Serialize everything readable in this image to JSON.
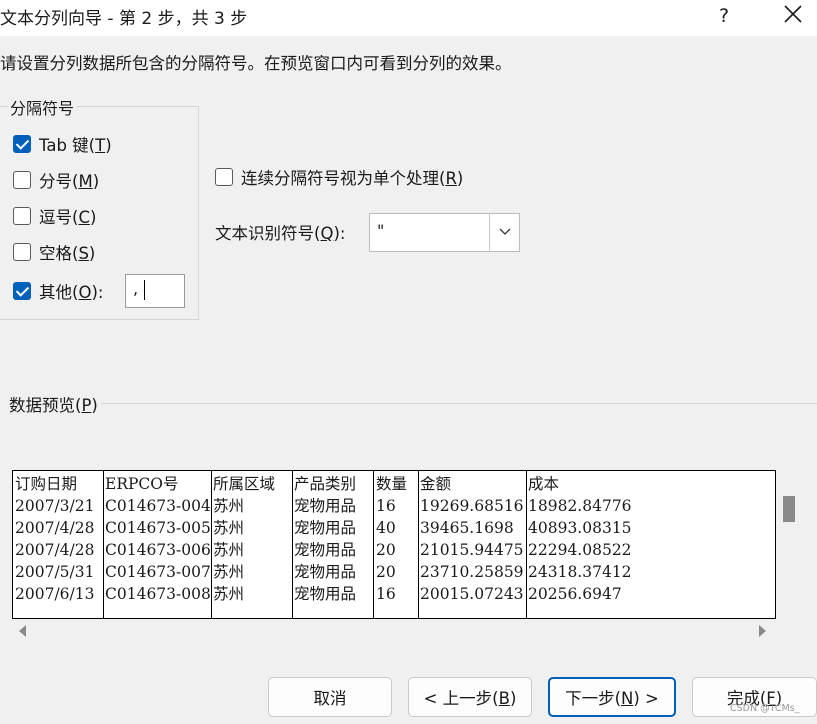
{
  "window": {
    "title": "文本分列向导 - 第 2 步，共 3 步",
    "help_label": "?"
  },
  "instruction": "请设置分列数据所包含的分隔符号。在预览窗口内可看到分列的效果。",
  "delimiters": {
    "group_label": "分隔符号",
    "items": [
      {
        "text": "Tab 键(",
        "key": "T",
        "close": ")",
        "checked": true
      },
      {
        "text": "分号(",
        "key": "M",
        "close": ")",
        "checked": false
      },
      {
        "text": "逗号(",
        "key": "C",
        "close": ")",
        "checked": false
      },
      {
        "text": "空格(",
        "key": "S",
        "close": ")",
        "checked": false
      },
      {
        "text": "其他(",
        "key": "O",
        "close": "):",
        "checked": true
      }
    ],
    "other_value": ","
  },
  "consecutive": {
    "text": "连续分隔符号视为单个处理(",
    "key": "R",
    "close": ")",
    "checked": false
  },
  "text_qualifier": {
    "text": "文本识别符号(",
    "key": "Q",
    "close": "):",
    "value": "\""
  },
  "preview": {
    "label_text": "数据预览(",
    "label_key": "P",
    "label_close": ")",
    "columns": [
      {
        "header": "订购日期",
        "cells": [
          "2007/3/21",
          "2007/4/28",
          "2007/4/28",
          "2007/5/31",
          "2007/6/13"
        ]
      },
      {
        "header": "ERPCO号",
        "cells": [
          "C014673-004",
          "C014673-005",
          "C014673-006",
          "C014673-007",
          "C014673-008"
        ]
      },
      {
        "header": "所属区域",
        "cells": [
          "苏州",
          "苏州",
          "苏州",
          "苏州",
          "苏州"
        ]
      },
      {
        "header": "产品类别",
        "cells": [
          "宠物用品",
          "宠物用品",
          "宠物用品",
          "宠物用品",
          "宠物用品"
        ]
      },
      {
        "header": "数量",
        "cells": [
          "16",
          "40",
          "20",
          "20",
          "16"
        ]
      },
      {
        "header": "金额",
        "cells": [
          "19269.68516",
          "39465.1698",
          "21015.94475",
          "23710.25859",
          "20015.07243"
        ]
      },
      {
        "header": "成本",
        "cells": [
          "18982.84776",
          "40893.08315",
          "22294.08522",
          "24318.37412",
          "20256.6947"
        ]
      }
    ]
  },
  "buttons": {
    "cancel": {
      "text": "取消"
    },
    "back": {
      "text": "< 上一步(",
      "key": "B",
      "close": ")"
    },
    "next": {
      "text": "下一步(",
      "key": "N",
      "close": ") >"
    },
    "finish": {
      "text": "完成(",
      "key": "F",
      "close": ")"
    }
  },
  "watermark": "CSDN @TCMs_"
}
